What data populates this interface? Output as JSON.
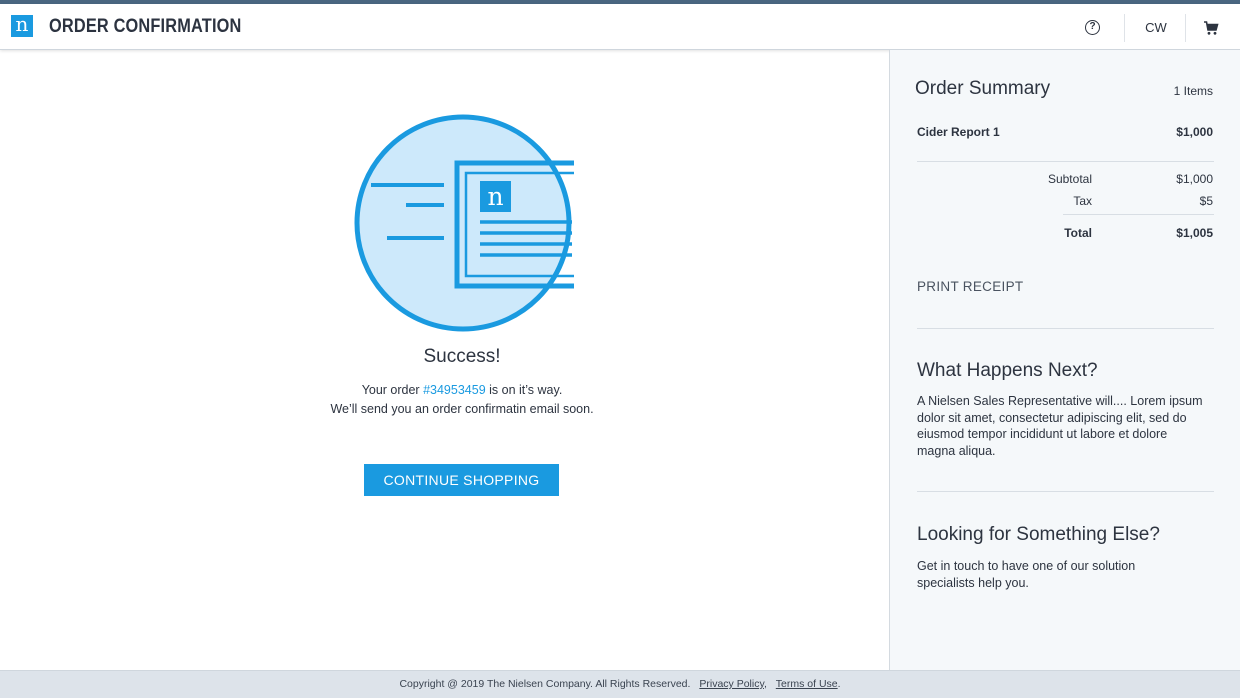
{
  "header": {
    "logo_letter": "n",
    "title": "ORDER CONFIRMATION",
    "help_label": "?",
    "user_initials": "CW",
    "cart_icon": "cart-icon"
  },
  "main": {
    "illustration_logo_letter": "n",
    "success_heading": "Success!",
    "message_prefix": "Your order ",
    "order_number": "#34953459",
    "message_suffix": " is on it’s way.",
    "message_line2": "We’ll send you an order confirmatin email soon.",
    "continue_label": "CONTINUE SHOPPING"
  },
  "summary": {
    "title": "Order Summary",
    "item_count": "1 Items",
    "items": [
      {
        "name": "Cider Report 1",
        "price": "$1,000"
      }
    ],
    "subtotal_label": "Subtotal",
    "subtotal_value": "$1,000",
    "tax_label": "Tax",
    "tax_value": "$5",
    "total_label": "Total",
    "total_value": "$1,005",
    "print_label": "PRINT RECEIPT"
  },
  "next": {
    "title": "What Happens Next?",
    "text": "A Nielsen Sales Representative will.... Lorem ipsum dolor sit amet, consectetur adipiscing elit, sed do eiusmod tempor incididunt ut labore et dolore magna aliqua."
  },
  "else_section": {
    "title": "Looking for Something Else?",
    "text": "Get in touch to have one of our solution specialists help you."
  },
  "footer": {
    "copyright": "Copyright @ 2019 The Nielsen Company. All Rights Reserved.",
    "privacy_label": "Privacy Policy",
    "terms_label": "Terms of Use"
  },
  "colors": {
    "accent": "#1a9ae0",
    "illustration_fill": "#cde9fb",
    "topline": "#4a6680"
  }
}
